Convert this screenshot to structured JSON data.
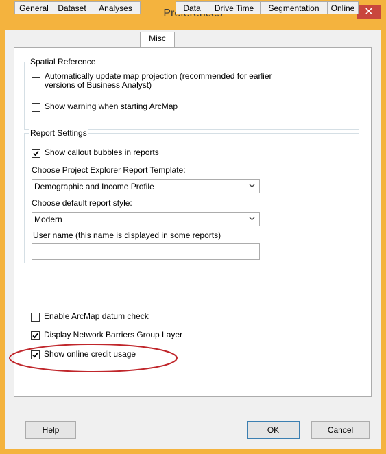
{
  "window": {
    "title": "Preferences",
    "close_glyph": "✕"
  },
  "tabs": [
    {
      "label": "General"
    },
    {
      "label": "Dataset"
    },
    {
      "label": "Analyses"
    },
    {
      "label": "Misc"
    },
    {
      "label": "Data"
    },
    {
      "label": "Drive Time"
    },
    {
      "label": "Segmentation"
    },
    {
      "label": "Online"
    }
  ],
  "active_tab": "Misc",
  "spatial_reference": {
    "title": "Spatial Reference",
    "auto_update_line1": "Automatically update map projection (recommended for earlier",
    "auto_update_line2": "versions of Business Analyst)",
    "auto_update_checked": false,
    "show_warning_label": "Show warning when starting ArcMap",
    "show_warning_checked": false
  },
  "report_settings": {
    "title": "Report Settings",
    "callout_label": "Show callout bubbles in reports",
    "callout_checked": true,
    "template_label": "Choose Project Explorer Report Template:",
    "template_value": "Demographic and Income Profile",
    "style_label": "Choose default report style:",
    "style_value": "Modern",
    "username_label": "User name (this name is displayed in some reports)",
    "username_value": ""
  },
  "misc_options": [
    {
      "label": "Enable ArcMap datum check",
      "checked": false
    },
    {
      "label": "Display Network Barriers Group Layer",
      "checked": true
    },
    {
      "label": "Show online credit usage",
      "checked": true
    }
  ],
  "buttons": {
    "help": "Help",
    "ok": "OK",
    "cancel": "Cancel"
  },
  "colors": {
    "title_bar": "#f4b33e",
    "close_button": "#c9463d",
    "annotation_ellipse": "#c0262b"
  }
}
